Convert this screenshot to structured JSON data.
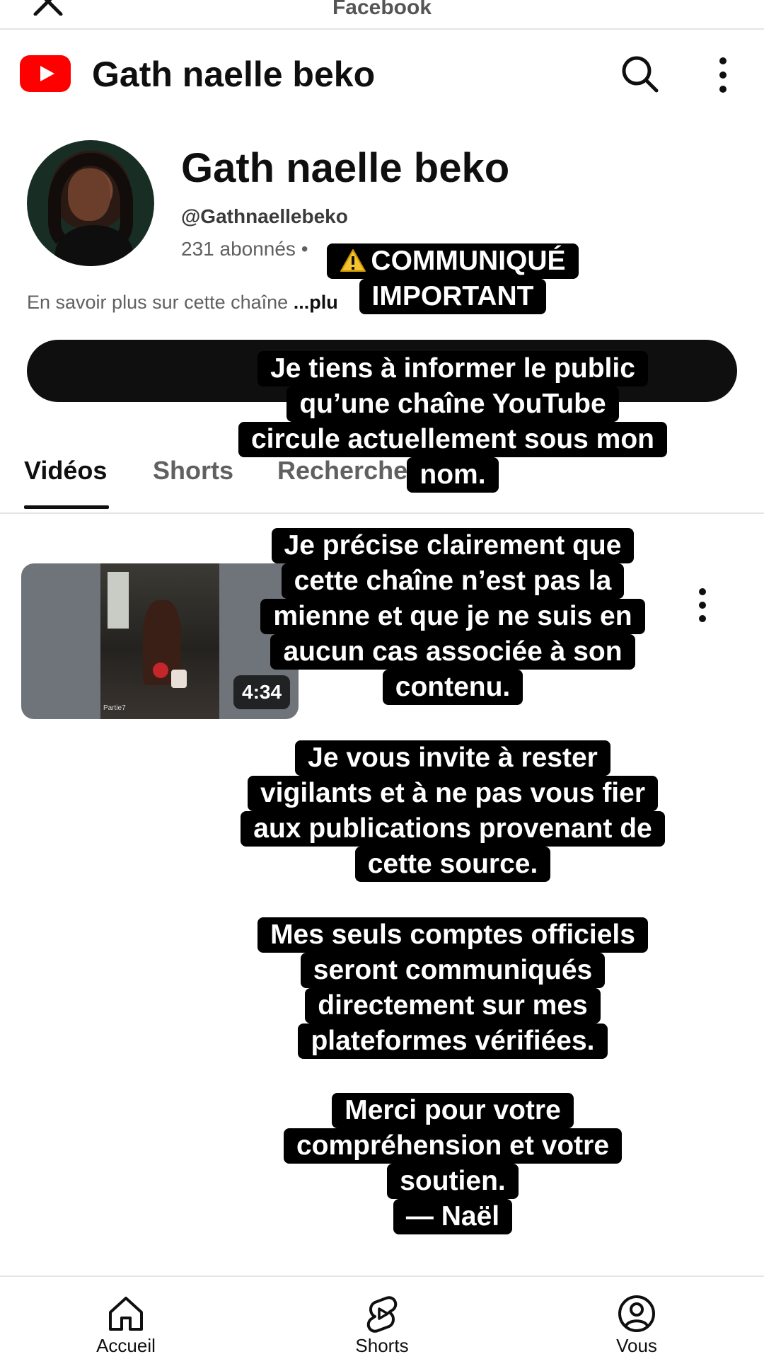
{
  "topbar": {
    "title": "Facebook",
    "close_icon": "close-icon"
  },
  "header": {
    "logo_icon": "youtube-logo-icon",
    "title": "Gath naelle beko",
    "search_icon": "search-icon",
    "more_icon": "more-vert-icon"
  },
  "channel": {
    "name": "Gath naelle beko",
    "handle": "@Gathnaellebeko",
    "subscribers": "231 abonnés • ",
    "description": "En savoir plus sur cette chaîne ",
    "description_more": "...plu"
  },
  "tabs": [
    {
      "label": "Vidéos",
      "active": true
    },
    {
      "label": "Shorts",
      "active": false
    },
    {
      "label": "Recherche",
      "active": false
    }
  ],
  "video": {
    "duration": "4:34",
    "thumb_caption": "Partie7"
  },
  "overlay": {
    "block1": [
      "COMMUNIQUÉ",
      "IMPORTANT"
    ],
    "block2": [
      "Je tiens à informer le public",
      "qu’une chaîne YouTube",
      "circule actuellement sous mon",
      "nom."
    ],
    "block3": [
      "Je précise clairement que",
      "cette chaîne n’est pas la",
      "mienne et que je ne suis en",
      "aucun cas associée à son",
      "contenu."
    ],
    "block4": [
      "Je vous invite à rester",
      "vigilants et à ne pas vous fier",
      "aux publications provenant de",
      "cette source."
    ],
    "block5": [
      "Mes seuls comptes officiels",
      "seront communiqués",
      "directement sur mes",
      "plateformes vérifiées."
    ],
    "block6": [
      "Merci pour votre",
      "compréhension et votre",
      "soutien.",
      "— Naël"
    ],
    "warning_icon": "warning-icon"
  },
  "bottom_nav": [
    {
      "label": "Accueil",
      "icon": "home-icon"
    },
    {
      "label": "Shorts",
      "icon": "shorts-icon"
    },
    {
      "label": "Vous",
      "icon": "account-icon"
    }
  ],
  "colors": {
    "youtube_red": "#ff0000",
    "text": "#0f0f0f",
    "secondary_text": "#606060",
    "overlay_bg": "#000000",
    "overlay_text": "#ffffff"
  }
}
